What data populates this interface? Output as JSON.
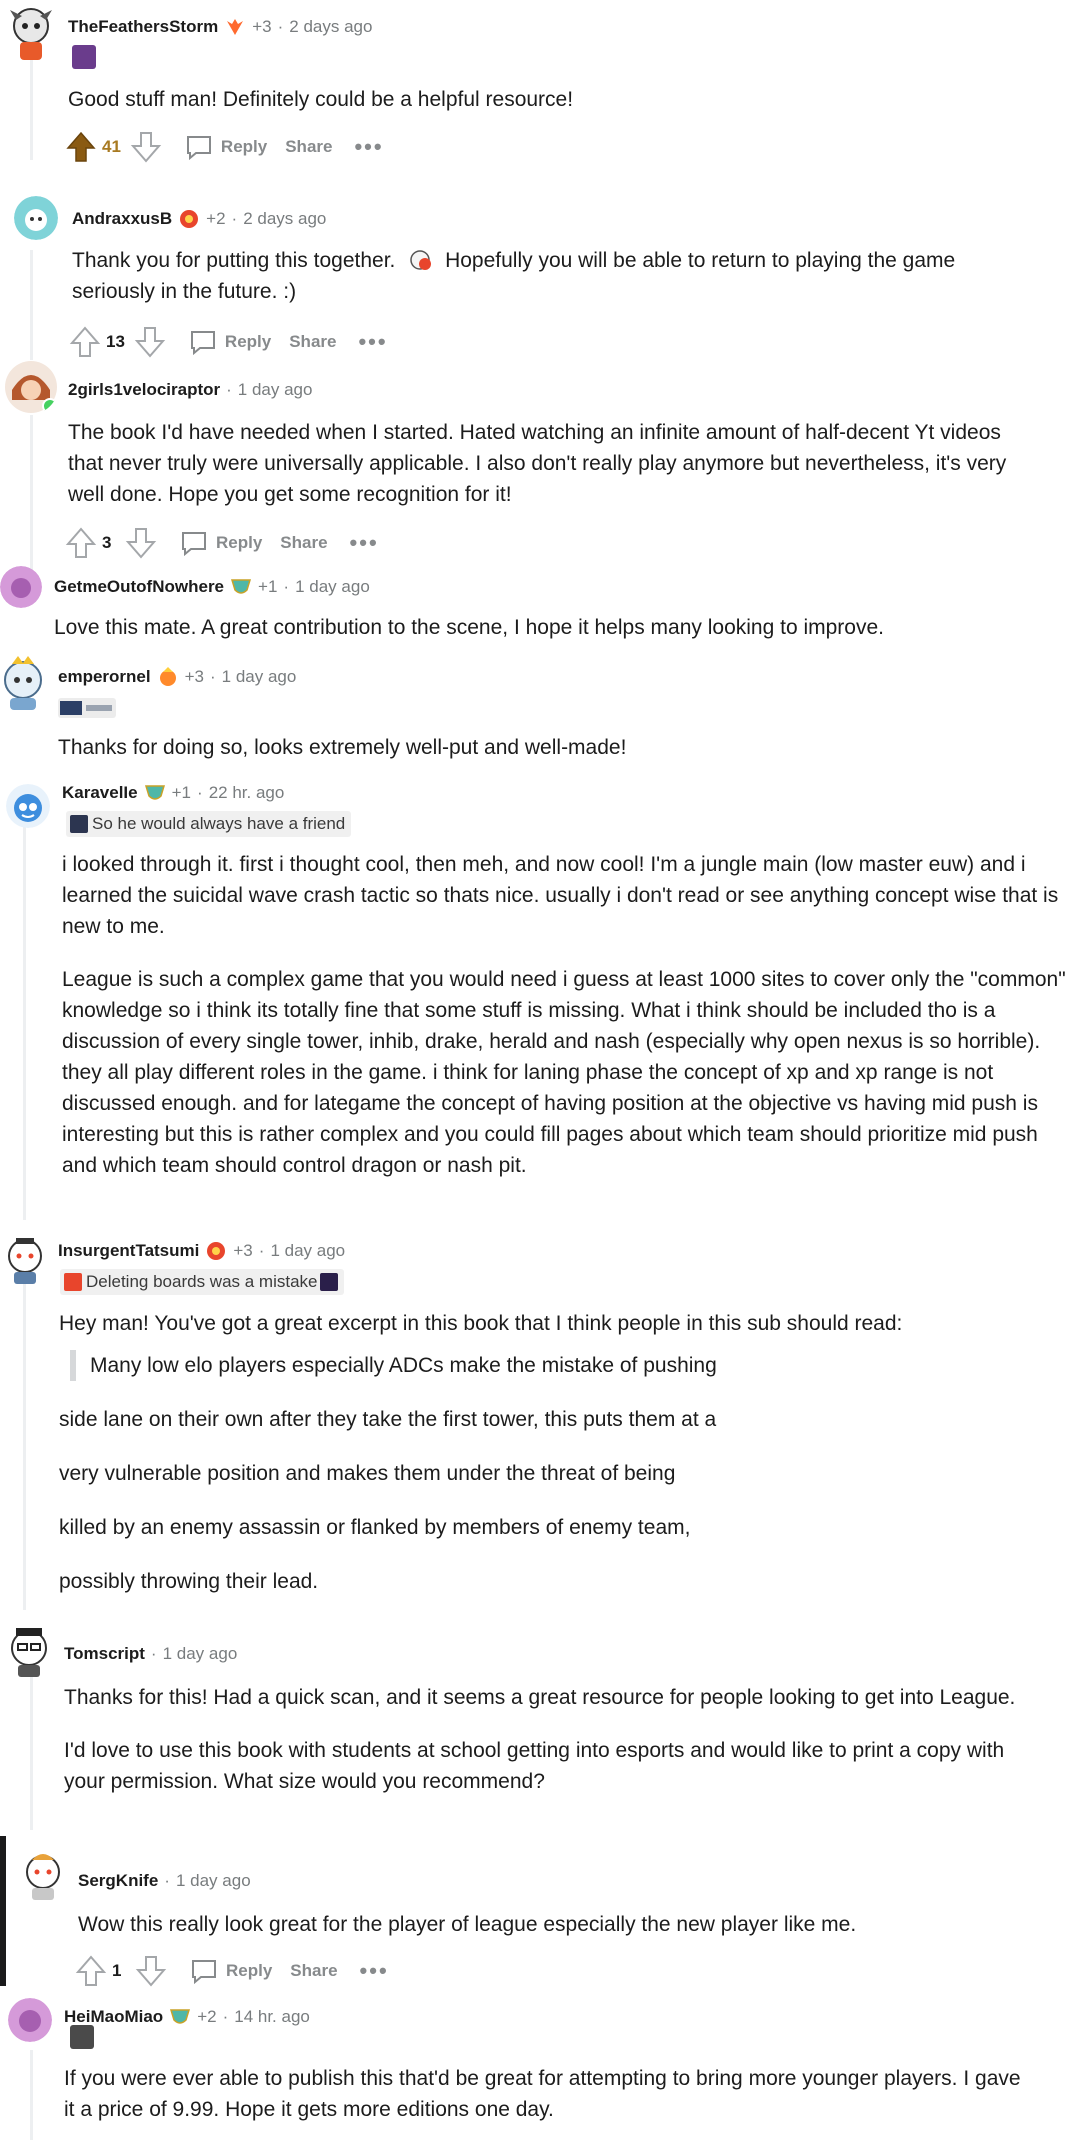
{
  "comments": [
    {
      "author": "TheFeathersStorm",
      "plus": "+3",
      "time": "2 days ago",
      "body": [
        "Good stuff man! Definitely could be a helpful resource!"
      ],
      "score": "41",
      "reply": "Reply",
      "share": "Share"
    },
    {
      "author": "AndraxxusB",
      "plus": "+2",
      "time": "2 days ago",
      "body_a": "Thank you for putting this together.",
      "body_b": "Hopefully you will be able to return to playing the game seriously in the future. :)",
      "score": "13",
      "reply": "Reply",
      "share": "Share"
    },
    {
      "author": "2girls1velociraptor",
      "time": "1 day ago",
      "body": [
        "The book I'd have needed when I started. Hated watching an infinite amount of half-decent Yt videos that never truly were universally applicable. I also don't really play anymore but nevertheless, it's very well done. Hope you get some recognition for it!"
      ],
      "score": "3",
      "reply": "Reply",
      "share": "Share"
    },
    {
      "author": "GetmeOutofNowhere",
      "plus": "+1",
      "time": "1 day ago",
      "body": [
        "Love this mate. A great contribution to the scene, I hope it helps many looking to improve."
      ]
    },
    {
      "author": "emperornel",
      "plus": "+3",
      "time": "1 day ago",
      "body": [
        "Thanks for doing so, looks extremely well-put and well-made!"
      ]
    },
    {
      "author": "KaravelIe",
      "plus": "+1",
      "time": "22 hr. ago",
      "flair": "So he would always have a friend",
      "body": [
        "i looked through it. first i thought cool, then meh, and now cool! I'm a jungle main (low master euw) and i learned the suicidal wave crash tactic so thats nice. usually i don't read or see anything concept wise that is new to me.",
        "League is such a complex game that you would need i guess at least 1000 sites to cover only the \"common\" knowledge so i think its totally fine that some stuff is missing. What i think should be included tho is a discussion of every single tower, inhib, drake, herald and nash (especially why open nexus is so horrible). they all play different roles in the game. i think for laning phase the concept of xp and xp range is not discussed enough. and for lategame the concept of having position at the objective vs having mid push is interesting but this is rather complex and you could fill pages about which team should prioritize mid push and which team should control dragon or nash pit."
      ]
    },
    {
      "author": "InsurgentTatsumi",
      "plus": "+3",
      "time": "1 day ago",
      "flair": "Deleting boards was a mistake",
      "intro": "Hey man! You've got a great excerpt in this book that I think people in this sub should read:",
      "quote": "Many low elo players especially ADCs make the mistake of pushing",
      "lines": [
        "side lane on their own after they take the first tower, this puts them at a",
        "very vulnerable position and makes them under the threat of being",
        "killed by an enemy assassin or flanked by members of enemy team,",
        "possibly throwing their lead."
      ]
    },
    {
      "author": "Tomscript",
      "time": "1 day ago",
      "body": [
        "Thanks for this! Had a quick scan, and it seems a great resource for people looking to get into League.",
        "I'd love to use this book with students at school getting into esports and would like to print a copy with your permission. What size would you recommend?"
      ]
    },
    {
      "author": "SergKnife",
      "time": "1 day ago",
      "body": [
        "Wow this really look great for the player of league especially the new player like me."
      ],
      "score": "1",
      "reply": "Reply",
      "share": "Share"
    },
    {
      "author": "HeiMaoMiao",
      "plus": "+2",
      "time": "14 hr. ago",
      "body": [
        "If you were ever able to publish this that'd be great for attempting to bring more younger players. I gave it a price of 9.99. Hope it gets more editions one day."
      ]
    }
  ],
  "colors": {
    "upvoted": "#a87a22",
    "meta": "#787c7e",
    "rail": "#edeff1"
  },
  "icons": [
    "upvote-icon",
    "downvote-icon",
    "reply-icon",
    "more-icon",
    "award-icon"
  ]
}
